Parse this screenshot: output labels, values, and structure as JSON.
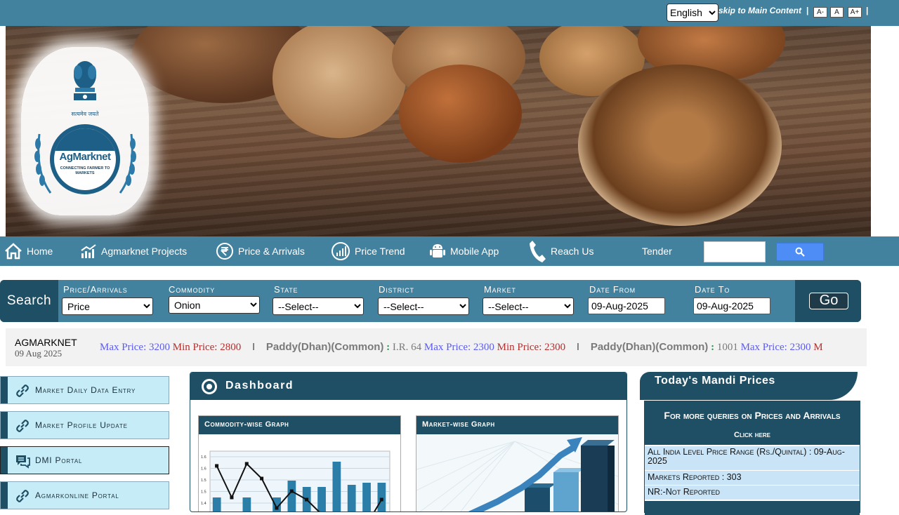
{
  "topbar": {
    "language": "English",
    "language_options": [
      "English"
    ],
    "skip_link": "skip to Main Content",
    "separator": "|",
    "font_decrease": "A-",
    "font_normal": "A",
    "font_increase": "A+"
  },
  "banner": {
    "emblem_caption": "सत्यमेव जयते",
    "logo_name": "AgMarknet",
    "logo_tagline": "CONNECTING FARMER TO MARKETS"
  },
  "nav": {
    "items": [
      {
        "label": "Home",
        "icon": "home-icon"
      },
      {
        "label": "Agmarknet Projects",
        "icon": "chart-up-icon"
      },
      {
        "label": "Price & Arrivals",
        "icon": "rupee-icon"
      },
      {
        "label": "Price Trend",
        "icon": "signal-icon"
      },
      {
        "label": "Mobile App",
        "icon": "android-icon"
      },
      {
        "label": "Reach Us",
        "icon": "phone-icon"
      },
      {
        "label": "Tender",
        "icon": ""
      }
    ],
    "search_placeholder": "",
    "search_icon": "search-icon"
  },
  "search": {
    "label": "Search",
    "fields": [
      {
        "label": "Price/Arrivals",
        "value": "Price"
      },
      {
        "label": "Commodity",
        "value": "Onion"
      },
      {
        "label": "State",
        "value": "--Select--"
      },
      {
        "label": "District",
        "value": "--Select--"
      },
      {
        "label": "Market",
        "value": "--Select--"
      }
    ],
    "date_from_label": "Date From",
    "date_from": "09-Aug-2025",
    "date_to_label": "Date To",
    "date_to": "09-Aug-2025",
    "go": "Go"
  },
  "ticker": {
    "org": "AGMARKNET",
    "date": "09 Aug 2025",
    "items": [
      {
        "commodity": "",
        "variety": "",
        "max": "Max Price: 3200",
        "min": "Min Price: 2800"
      },
      {
        "commodity": "Paddy(Dhan)(Common)",
        "variety": "I.R. 64",
        "max": "Max Price: 2300",
        "min": "Min Price: 2300"
      },
      {
        "commodity": "Paddy(Dhan)(Common)",
        "variety": "1001",
        "max": "Max Price: 2300",
        "min": "M"
      }
    ],
    "colon": ":",
    "bar": "I"
  },
  "sidebar": {
    "links": [
      {
        "label": "Market Daily Data Entry",
        "icon": "link-icon"
      },
      {
        "label": "Market Profile Update",
        "icon": "link-icon"
      },
      {
        "label": "DMI Portal",
        "icon": "chat-icon"
      },
      {
        "label": "Agmarkonline Portal",
        "icon": "link-icon"
      }
    ]
  },
  "dashboard": {
    "title": "Dashboard",
    "commodity_graph_title": "Commodity-wise Graph",
    "market_graph_title": "Market-wise Graph"
  },
  "chart_data": {
    "type": "bar",
    "yticks": [
      "1.6",
      "1.6",
      "1.5",
      "1.5",
      "1.4"
    ],
    "bars": [
      1.43,
      0.2,
      1.43,
      0.2,
      1.43,
      1.51,
      1.48,
      1.48,
      1.6,
      1.49,
      1.5,
      1.5
    ],
    "line": [
      1.58,
      1.43,
      1.59,
      1.52,
      1.38,
      1.46,
      1.42,
      1.35,
      1.3,
      1.3,
      1.3,
      1.42
    ],
    "ylim": [
      1.35,
      1.65
    ]
  },
  "mandi": {
    "title": "Today's Mandi Prices",
    "query": "For more queries on Prices and Arrivals",
    "click_here": "Click here",
    "range_text": "All India Level Price Range (Rs./Quintal) : 09-Aug-2025",
    "markets_reported": "Markets Reported : 303",
    "nr_text": "NR:-Not Reported"
  },
  "colors": {
    "primary": "#42829f",
    "dark": "#1e4f64",
    "sidebar_bg": "#c6ecf8"
  }
}
